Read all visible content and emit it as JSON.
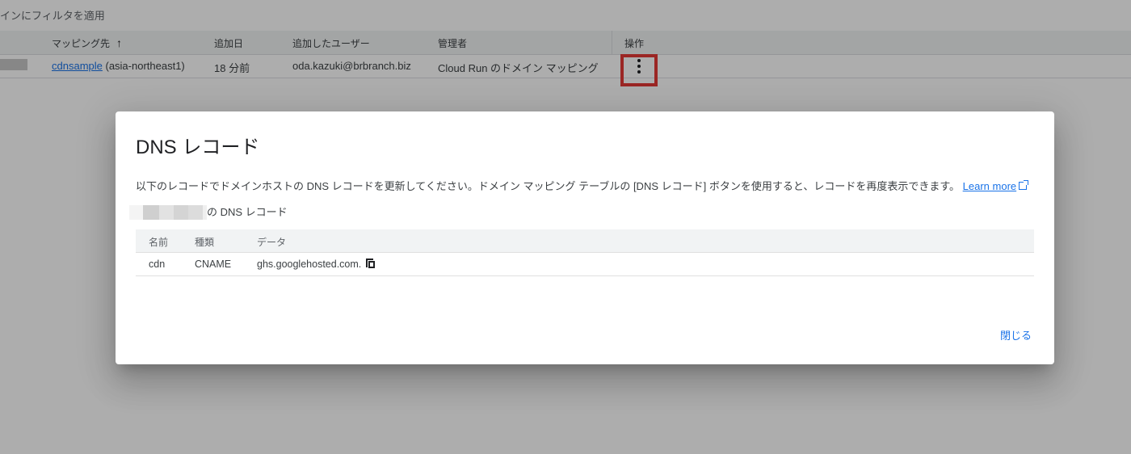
{
  "filter": {
    "text": "インにフィルタを適用"
  },
  "table": {
    "headers": {
      "mapping": "マッピング先",
      "added_date": "追加日",
      "added_user": "追加したユーザー",
      "admin": "管理者",
      "actions": "操作"
    },
    "row": {
      "mapping_link": "cdnsample",
      "mapping_region": " (asia-northeast1)",
      "added_date": "18 分前",
      "added_user": "oda.kazuki@brbranch.biz",
      "admin": "Cloud Run のドメイン マッピング"
    }
  },
  "dialog": {
    "title": "DNS レコード",
    "description": "以下のレコードでドメインホストの DNS レコードを更新してください。ドメイン マッピング テーブルの [DNS レコード] ボタンを使用すると、レコードを再度表示できます。",
    "learn_more": "Learn more",
    "domain_suffix": "の DNS レコード",
    "dns_table": {
      "headers": {
        "name": "名前",
        "type": "種類",
        "data": "データ"
      },
      "rows": [
        {
          "name": "cdn",
          "type": "CNAME",
          "data": "ghs.googlehosted.com."
        }
      ]
    },
    "close_label": "閉じる"
  },
  "colors": {
    "link": "#1a73e8",
    "highlight_border": "#e53935",
    "scrim": "rgba(0,0,0,0.32)"
  },
  "icons": {
    "sort": "arrow-up-icon",
    "more": "more-vert-icon",
    "external": "external-link-icon",
    "copy": "copy-icon"
  }
}
